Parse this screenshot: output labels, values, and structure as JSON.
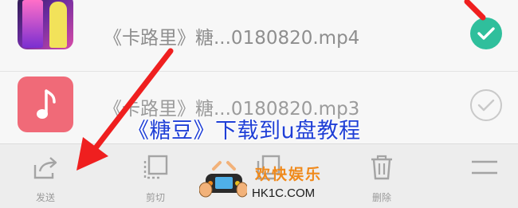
{
  "files": [
    {
      "name": "《卡路里》糖...0180820.mp4",
      "type": "video",
      "selected": true
    },
    {
      "name": "《卡路里》糖...0180820.mp3",
      "type": "audio",
      "selected": false
    }
  ],
  "overlay": {
    "title": "《糖豆》下载到u盘教程"
  },
  "toolbar": {
    "send": {
      "icon": "share-icon",
      "label": "发送"
    },
    "cut": {
      "icon": "cut-icon",
      "label": "剪切"
    },
    "copy": {
      "icon": "copy-icon",
      "label": ""
    },
    "delete": {
      "icon": "trash-icon",
      "label": "删除"
    },
    "more": {
      "icon": "menu-icon",
      "label": ""
    }
  },
  "watermark": {
    "cn": "欢快娱乐",
    "en": "HK1C.COM"
  },
  "colors": {
    "accent": "#2fbf9c",
    "arrow": "#ef1f1f",
    "title": "#1f3fd6",
    "audio_thumb": "#f06a78"
  }
}
